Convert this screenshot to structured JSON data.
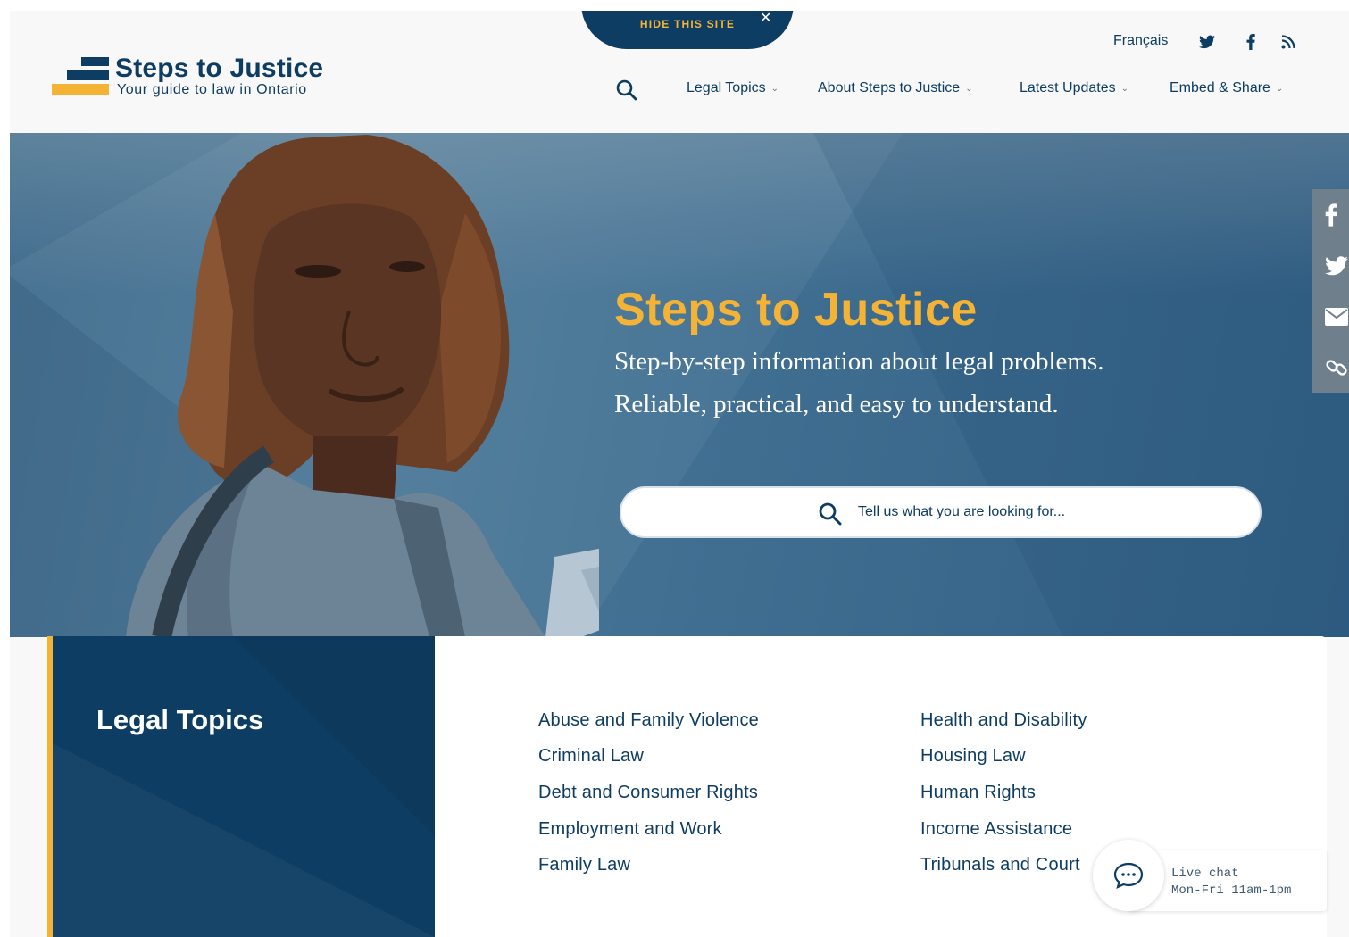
{
  "header": {
    "logo_title": "Steps to Justice",
    "logo_subtitle": "Your guide to law in Ontario",
    "hide_site": "HIDE THIS SITE",
    "hide_close": "✕",
    "language": "Français",
    "social": [
      "twitter-icon",
      "facebook-icon",
      "rss-icon"
    ],
    "nav": [
      {
        "label": "Legal Topics",
        "caret": "⌄"
      },
      {
        "label": "About Steps to Justice",
        "caret": "⌄"
      },
      {
        "label": "Latest Updates",
        "caret": "⌄"
      },
      {
        "label": "Embed & Share",
        "caret": "⌄"
      }
    ]
  },
  "hero": {
    "title": "Steps to Justice",
    "line1": "Step-by-step information about legal problems.",
    "line2": "Reliable, practical, and easy to understand.",
    "search_placeholder": "Tell us what you are looking for..."
  },
  "share_bar": [
    "facebook-icon",
    "twitter-icon",
    "email-icon",
    "link-icon"
  ],
  "topics": {
    "heading": "Legal Topics",
    "column1": [
      "Abuse and Family Violence",
      "Criminal Law",
      "Debt and Consumer Rights",
      "Employment and Work",
      "Family Law"
    ],
    "column2": [
      "Health and Disability",
      "Housing Law",
      "Human Rights",
      "Income Assistance",
      "Tribunals and Court"
    ]
  },
  "chat": {
    "title": "Live chat",
    "hours": "Mon-Fri 11am-1pm"
  },
  "colors": {
    "navy": "#0e3d63",
    "gold": "#f5b335",
    "hero_blue": "#3f6e91"
  }
}
